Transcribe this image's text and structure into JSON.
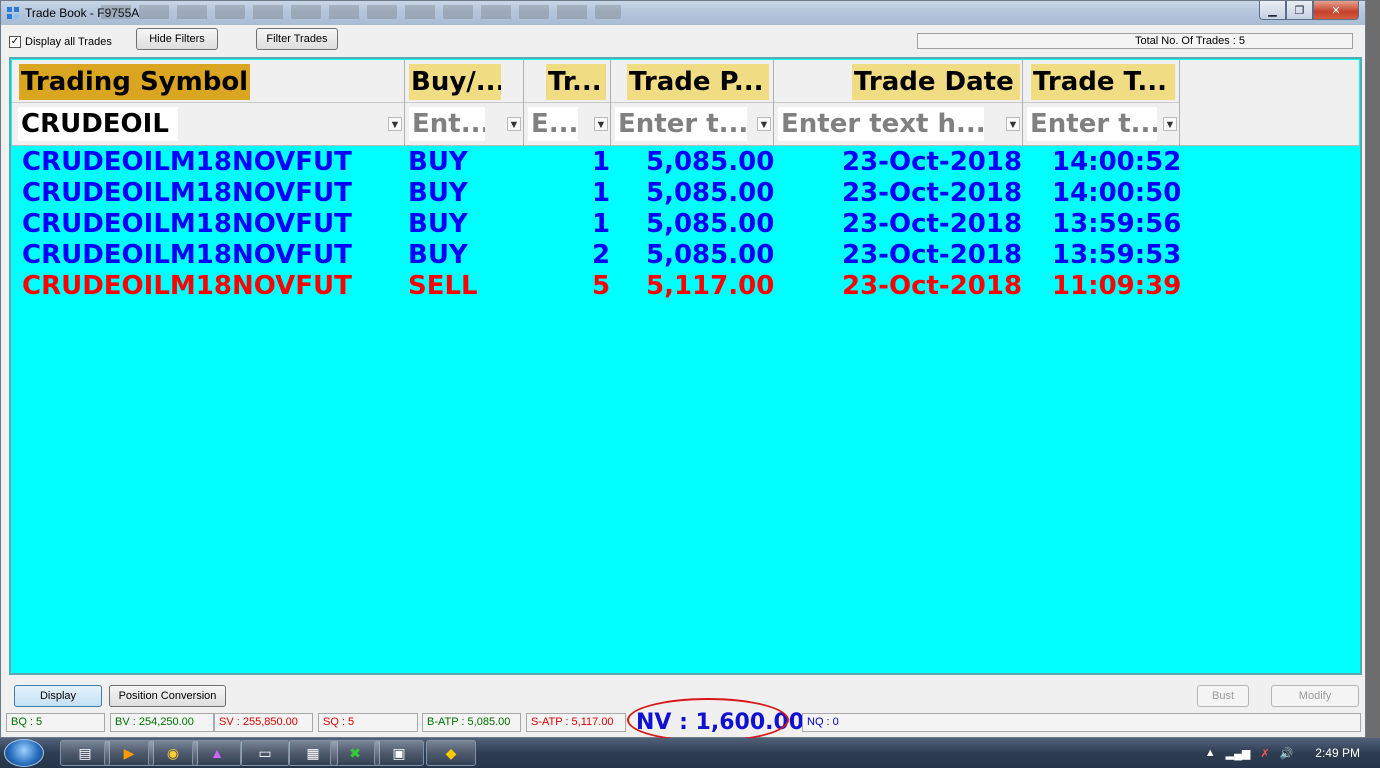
{
  "window": {
    "title": "Trade Book - F9755A"
  },
  "toolbar": {
    "display_all_label": "Display all Trades",
    "hide_filters_label": "Hide Filters",
    "filter_trades_label": "Filter Trades",
    "total_trades_text": "Total No. Of Trades : 5"
  },
  "grid": {
    "columns": [
      {
        "header": "Trading Symbol",
        "filter": "CRUDEOIL"
      },
      {
        "header": "Buy/...",
        "filter": "Ent..."
      },
      {
        "header": "Tr...",
        "filter": "E..."
      },
      {
        "header": "Trade P...",
        "filter": "Enter t..."
      },
      {
        "header": "Trade Date",
        "filter": "Enter text h..."
      },
      {
        "header": "Trade T...",
        "filter": "Enter t..."
      }
    ],
    "rows": [
      {
        "symbol": "CRUDEOILM18NOVFUT",
        "side": "BUY",
        "qty": "1",
        "price": "5,085.00",
        "date": "23-Oct-2018",
        "time": "14:00:52"
      },
      {
        "symbol": "CRUDEOILM18NOVFUT",
        "side": "BUY",
        "qty": "1",
        "price": "5,085.00",
        "date": "23-Oct-2018",
        "time": "14:00:50"
      },
      {
        "symbol": "CRUDEOILM18NOVFUT",
        "side": "BUY",
        "qty": "1",
        "price": "5,085.00",
        "date": "23-Oct-2018",
        "time": "13:59:56"
      },
      {
        "symbol": "CRUDEOILM18NOVFUT",
        "side": "BUY",
        "qty": "2",
        "price": "5,085.00",
        "date": "23-Oct-2018",
        "time": "13:59:53"
      },
      {
        "symbol": "CRUDEOILM18NOVFUT",
        "side": "SELL",
        "qty": "5",
        "price": "5,117.00",
        "date": "23-Oct-2018",
        "time": "11:09:39"
      }
    ]
  },
  "bottom": {
    "display_label": "Display",
    "position_conversion_label": "Position Conversion",
    "bust_label": "Bust",
    "modify_label": "Modify"
  },
  "status": {
    "bq": "BQ : 5",
    "bv": "BV : 254,250.00",
    "sv": "SV : 255,850.00",
    "sq": "SQ : 5",
    "batp": "B-ATP : 5,085.00",
    "satp": "S-ATP : 5,117.00",
    "nv": "NV : 1,600.00",
    "nq": "NQ : 0"
  },
  "taskbar": {
    "clock": "2:49 PM"
  },
  "colors": {
    "grid_bg": "#00ffff",
    "buy": "#0000ff",
    "sell": "#ff0000",
    "header_active": "#daa520",
    "header": "#f0dc82"
  }
}
